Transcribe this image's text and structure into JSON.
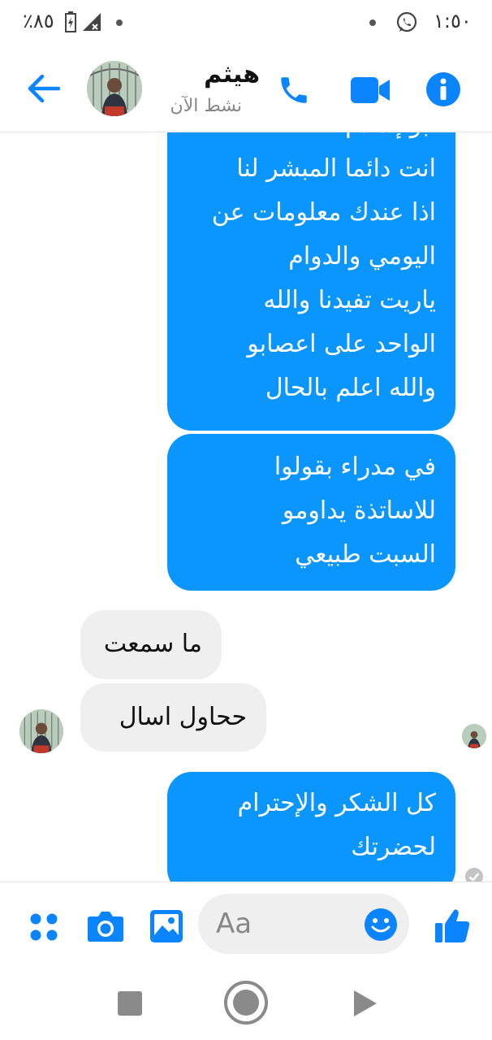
{
  "status_bar": {
    "battery_text": "٪٨٥",
    "time": "١:٥٠"
  },
  "header": {
    "contact_name": "هيثم",
    "presence": "نشط الآن",
    "icons": [
      "back-arrow-icon",
      "avatar",
      "phone-icon",
      "video-camera-icon",
      "info-icon"
    ]
  },
  "messages": [
    {
      "dir": "out",
      "lines": [
        "ابو إسلام",
        "انت دائما المبشر لنا",
        "اذا عندك معلومات عن",
        "اليومي والدوام",
        "ياريت تفيدنا والله",
        "الواحد على اعصابو",
        "والله اعلم بالحال"
      ]
    },
    {
      "dir": "out",
      "lines": [
        "في مدراء بقولوا",
        "للاساتذة يداومو",
        "السبت طبيعي"
      ]
    },
    {
      "dir": "in",
      "lines": [
        "ما سمعت"
      ]
    },
    {
      "dir": "in",
      "lines": [
        "ححاول اسال"
      ]
    },
    {
      "dir": "out",
      "lines": [
        "كل الشكر والإحترام",
        "لحضرتك"
      ]
    }
  ],
  "composer": {
    "placeholder": "Aa",
    "icons": [
      "apps-grid-icon",
      "camera-icon",
      "gallery-icon",
      "emoji-icon",
      "thumbs-up-icon"
    ]
  },
  "accent_color": "#0a84ff",
  "bubble_color": "#0a95ff"
}
